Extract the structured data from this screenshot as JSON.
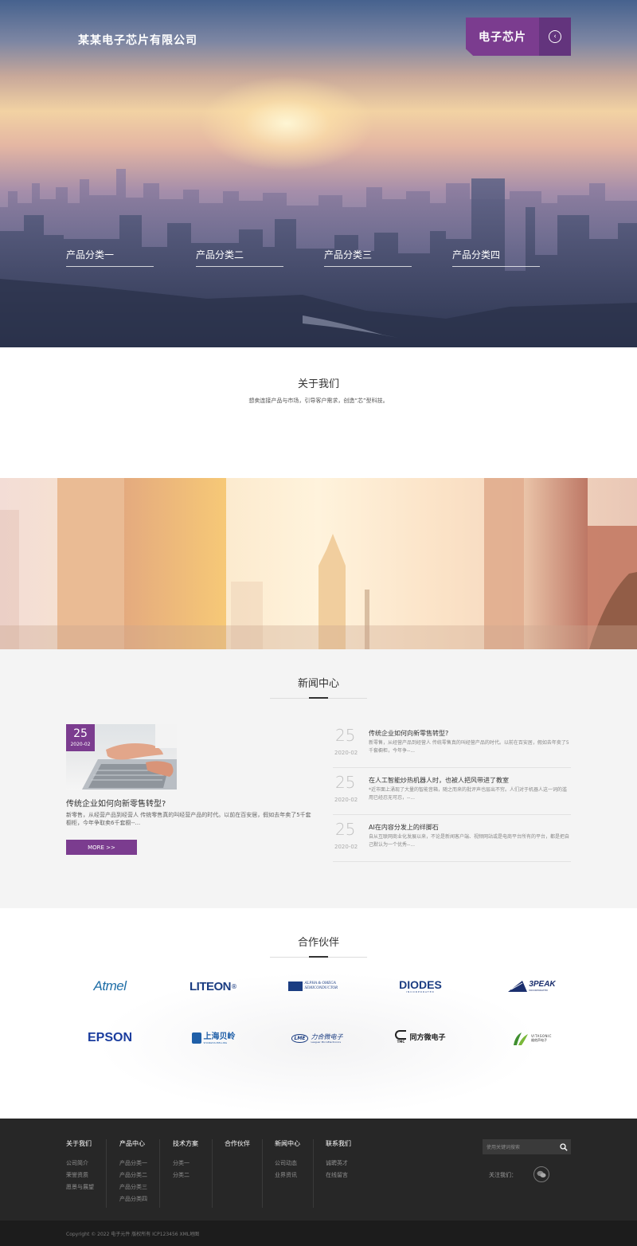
{
  "colors": {
    "accent": "#7b3c8f",
    "footer_bg": "#272727"
  },
  "header": {
    "site_title": "某某电子芯片有限公司",
    "badge_label": "电子芯片",
    "badge_icon": "chevron-left-icon"
  },
  "hero": {
    "categories": [
      "产品分类一",
      "产品分类二",
      "产品分类三",
      "产品分类四"
    ]
  },
  "about": {
    "title": "关于我们",
    "subtitle": "想卖连接产品与市场，引导客户需求，创造“芯”型科技。"
  },
  "news": {
    "title": "新闻中心",
    "featured": {
      "day": "25",
      "month": "2020-02",
      "title": "传统企业如何向新零售转型?",
      "summary": "新零售，从经营产品到经营人 传统零售真的叫经营产品的时代。以前在百安居，假如去年卖了5千套橱柜，今年争取卖6千套橱--...",
      "more_label": "MORE >>"
    },
    "items": [
      {
        "day": "25",
        "month": "2020-02",
        "title": "传统企业如何向新零售转型?",
        "summary": "新零售，从经营产品到经营人 传统零售真的叫经营产品的时代。以前在百安居，假如去年卖了5千套橱柜，今年争--..."
      },
      {
        "day": "25",
        "month": "2020-02",
        "title": "在人工智能炒热机器人时，也被人把风带进了教室",
        "summary": "*近市面上涌现了大量的智能音箱，随之而来的批评声也层出不穷。人们对于机器人这一词的滥用已经忍无可忍，--..."
      },
      {
        "day": "25",
        "month": "2020-02",
        "title": "AI在内容分发上的绊脚石",
        "summary": "自从互联网商业化发展以来，不论是新闻客户端、视频网站或是电商平台所有的平台，都是把自己默认为一个优秀--..."
      }
    ]
  },
  "partners": {
    "title": "合作伙伴",
    "logos": [
      "Atmel",
      "LITEON",
      "ALPHA & OMEGA SEMICONDUCTOR",
      "DIODES",
      "3PEAK",
      "EPSON",
      "上海贝岭",
      "力合微电子",
      "同方微电子",
      "VITASONIC"
    ],
    "logo_sub": {
      "diodes": "INCORPORATED",
      "threepeak": "INCORPORATED",
      "belling": "SHANGHAI BELLING",
      "lme": "Leaguer MicroElectronics",
      "lme_mark": "LME",
      "tmc_mark": "TMC",
      "vitasonic_sub": "维他声电子",
      "liteon_reg": "®"
    }
  },
  "footer": {
    "columns": [
      {
        "heading": "关于我们",
        "links": [
          "公司简介",
          "荣誉资质",
          "愿景与展望"
        ]
      },
      {
        "heading": "产品中心",
        "links": [
          "产品分类一",
          "产品分类二",
          "产品分类三",
          "产品分类四"
        ]
      },
      {
        "heading": "技术方案",
        "links": [
          "分类一",
          "分类二"
        ]
      },
      {
        "heading": "合作伙伴",
        "links": []
      },
      {
        "heading": "新闻中心",
        "links": [
          "公司动态",
          "业界资讯"
        ]
      },
      {
        "heading": "联系我们",
        "links": [
          "诚聘英才",
          "在线留言"
        ]
      }
    ],
    "search_placeholder": "使用关键词搜索",
    "follow_label": "关注我们：",
    "copyright": "Copyright © 2022 电子元件 版权所有 ICP123456 XML地图"
  }
}
